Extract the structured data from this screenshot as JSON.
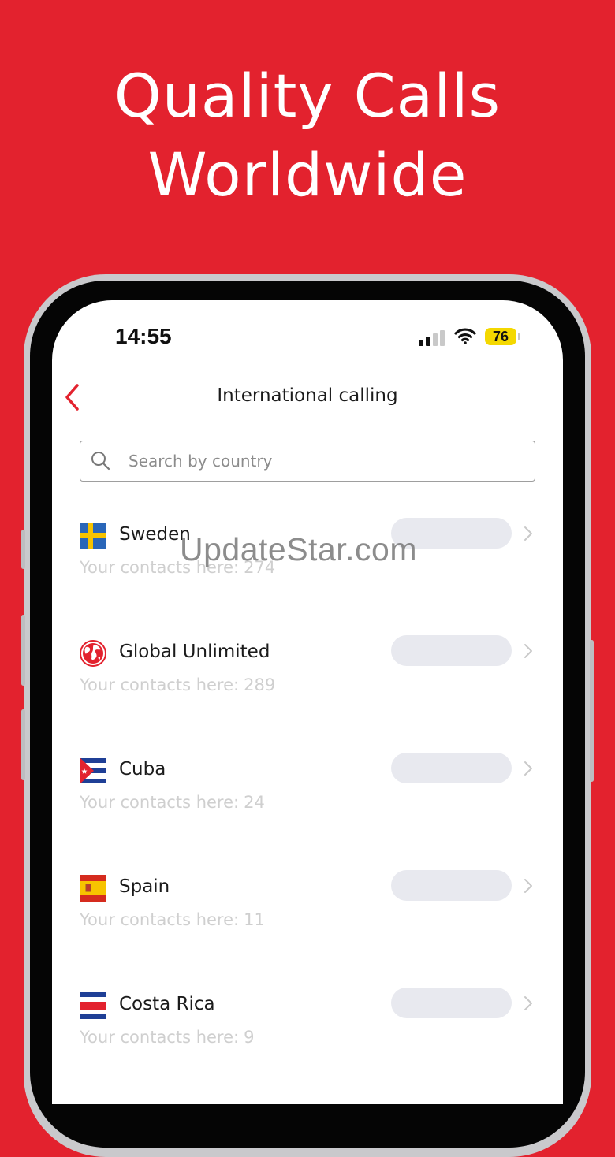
{
  "promo": {
    "headline_line1": "Quality Calls",
    "headline_line2": "Worldwide"
  },
  "status_bar": {
    "time": "14:55",
    "battery_level": "76",
    "cellular_signal_bars": 2,
    "wifi": "connected"
  },
  "nav": {
    "back_icon": "chevron-left-icon",
    "title": "International calling"
  },
  "search": {
    "placeholder": "Search by country",
    "icon": "search-icon"
  },
  "countries": [
    {
      "name": "Sweden",
      "flag": "sweden-flag-icon",
      "contacts_label": "Your contacts here:",
      "contacts_count": "274"
    },
    {
      "name": "Global Unlimited",
      "flag": "globe-icon",
      "contacts_label": "Your contacts here:",
      "contacts_count": "289"
    },
    {
      "name": "Cuba",
      "flag": "cuba-flag-icon",
      "contacts_label": "Your contacts here:",
      "contacts_count": "24"
    },
    {
      "name": "Spain",
      "flag": "spain-flag-icon",
      "contacts_label": "Your contacts here:",
      "contacts_count": "11"
    },
    {
      "name": "Costa Rica",
      "flag": "costa-rica-flag-icon",
      "contacts_label": "Your contacts here:",
      "contacts_count": "9"
    }
  ],
  "watermark": "UpdateStar.com",
  "colors": {
    "brand_red": "#e3222e",
    "battery_yellow": "#f4d800",
    "muted_text": "#cfcfcf",
    "pill_placeholder": "#e8e9ef"
  }
}
